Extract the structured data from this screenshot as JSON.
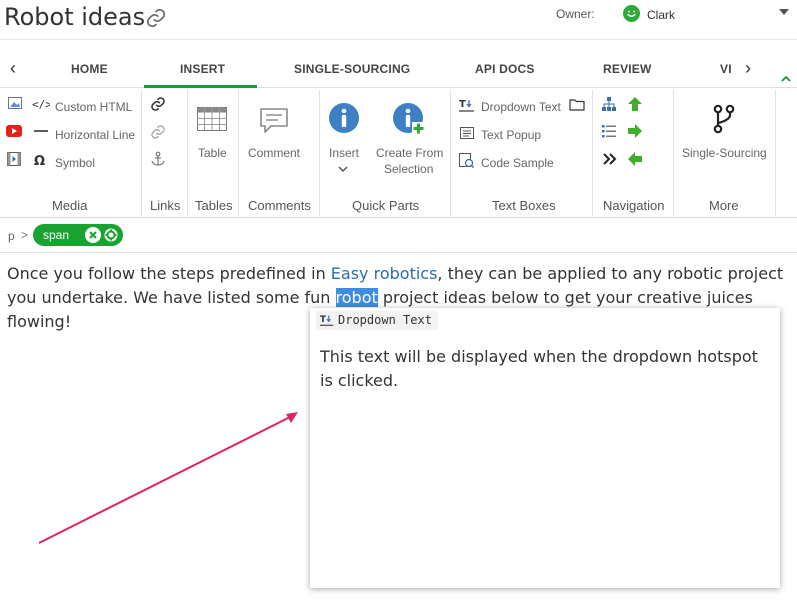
{
  "header": {
    "title": "Robot ideas",
    "owner_label": "Owner:",
    "owner_name": "Clark"
  },
  "tabs": [
    {
      "label": "HOME"
    },
    {
      "label": "INSERT"
    },
    {
      "label": "SINGLE-SOURCING"
    },
    {
      "label": "API DOCS"
    },
    {
      "label": "REVIEW"
    },
    {
      "label": "VI"
    }
  ],
  "ribbon": {
    "media": {
      "label": "Media",
      "items": [
        "Custom HTML",
        "Horizontal Line",
        "Symbol"
      ]
    },
    "links": {
      "label": "Links"
    },
    "tables": {
      "label": "Tables",
      "table_button": "Table"
    },
    "comments": {
      "label": "Comments",
      "comment_button": "Comment"
    },
    "quick_parts": {
      "label": "Quick Parts",
      "insert_button": "Insert",
      "create_line1": "Create From",
      "create_line2": "Selection"
    },
    "text_boxes": {
      "label": "Text Boxes",
      "items": [
        "Dropdown Text",
        "Text Popup",
        "Code Sample"
      ]
    },
    "navigation": {
      "label": "Navigation"
    },
    "more": {
      "label": "More",
      "single_sourcing_button": "Single-Sourcing"
    }
  },
  "breadcrumb": {
    "root": "p",
    "separator": ">",
    "pill": "span"
  },
  "content": {
    "part1": "Once you follow the steps predefined in ",
    "link": "Easy robotics",
    "part2": ", they can be applied to any robotic project you undertake. We have listed some fun ",
    "highlight": "robot",
    "part3": " project ideas below to get your creative juices flowing!"
  },
  "popup": {
    "tag": "Dropdown Text",
    "body": "This text will be displayed when the dropdown hotspot is clicked."
  },
  "colors": {
    "accent_green": "#1a9a34",
    "link_blue": "#2b6cb0",
    "selection_blue": "#3f8ce0",
    "arrow_red": "#e0245e"
  }
}
